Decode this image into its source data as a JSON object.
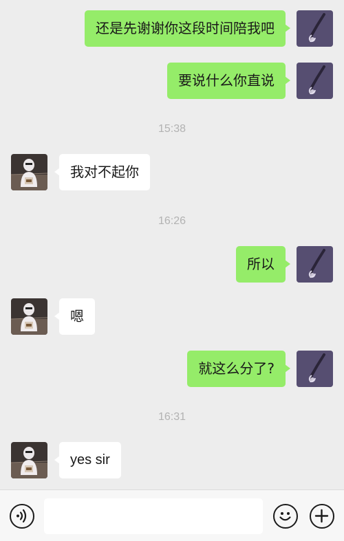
{
  "messages": [
    {
      "side": "out",
      "text": "还是先谢谢你这段时间陪我吧"
    },
    {
      "side": "out",
      "text": "要说什么你直说"
    },
    {
      "type": "time",
      "text": "15:38"
    },
    {
      "side": "in",
      "text": "我对不起你"
    },
    {
      "type": "time",
      "text": "16:26"
    },
    {
      "side": "out",
      "text": "所以"
    },
    {
      "side": "in",
      "text": "嗯"
    },
    {
      "side": "out",
      "text": "就这么分了?"
    },
    {
      "type": "time",
      "text": "16:31"
    },
    {
      "side": "in",
      "text": "yes sir"
    }
  ],
  "input_bar": {
    "voice_icon": "voice-icon",
    "message_value": "",
    "emoji_icon": "emoji-icon",
    "add_icon": "plus-icon"
  },
  "colors": {
    "background": "#ededed",
    "outgoing_bubble": "#95ec69",
    "incoming_bubble": "#ffffff",
    "timestamp": "#b2b2b2",
    "input_bar": "#f7f7f7"
  }
}
